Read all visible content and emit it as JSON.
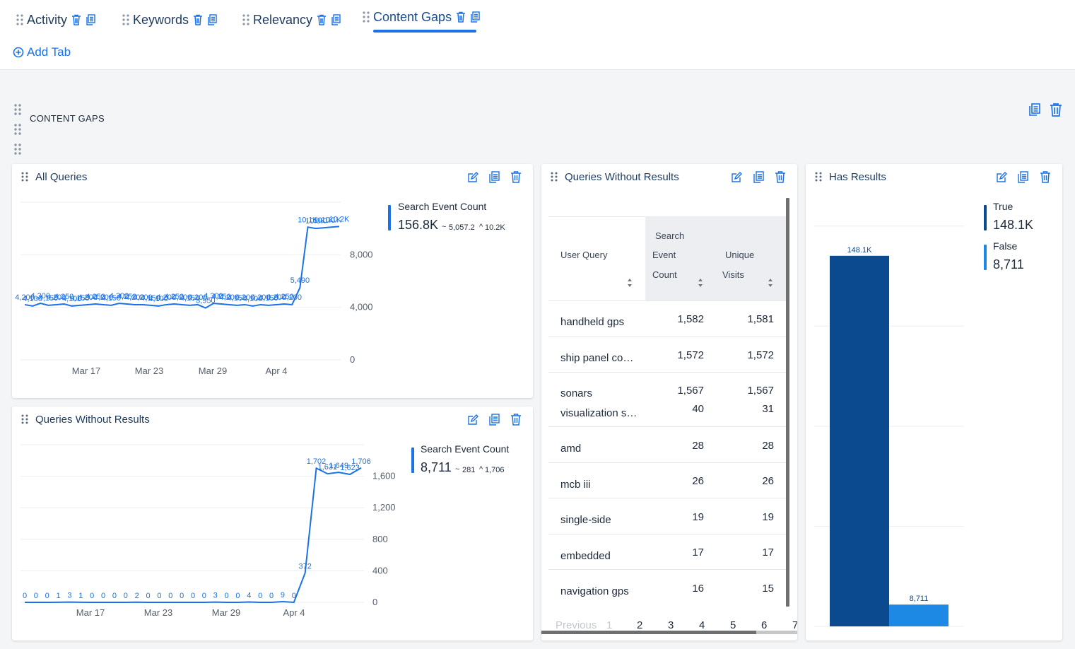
{
  "tabs": [
    {
      "label": "Activity"
    },
    {
      "label": "Keywords"
    },
    {
      "label": "Relevancy"
    },
    {
      "label": "Content Gaps"
    }
  ],
  "add_tab_label": "Add Tab",
  "section": {
    "title": "CONTENT GAPS"
  },
  "cards": {
    "all_queries": {
      "title": "All Queries",
      "legend_label": "Search Event Count",
      "legend_value": "156.8K",
      "legend_avg": "5,057.2",
      "legend_max": "10.2K",
      "legend_avg_symbol": "~",
      "legend_max_symbol": "^"
    },
    "queries_without_results_chart": {
      "title": "Queries Without Results",
      "legend_label": "Search Event Count",
      "legend_value": "8,711",
      "legend_avg": "281",
      "legend_max": "1,706",
      "legend_avg_symbol": "~",
      "legend_max_symbol": "^"
    },
    "queries_without_results_table": {
      "title": "Queries Without Results",
      "columns": [
        "User Query",
        "Search Event Count",
        "Unique Visits"
      ],
      "col2_lines": [
        "Search",
        "Event",
        "Count"
      ],
      "col3_lines": [
        "Unique",
        "Visits"
      ],
      "rows": [
        {
          "query": "handheld gps",
          "count": "1,582",
          "visits": "1,581"
        },
        {
          "query": "ship panel co…",
          "count": "1,572",
          "visits": "1,572"
        },
        {
          "query": "sonars",
          "count": "1,567",
          "visits": "1,567"
        },
        {
          "query": "visualization s…",
          "count": "40",
          "visits": "31"
        },
        {
          "query": "amd",
          "count": "28",
          "visits": "28"
        },
        {
          "query": "mcb iii",
          "count": "26",
          "visits": "26"
        },
        {
          "query": "single-side",
          "count": "19",
          "visits": "19"
        },
        {
          "query": "embedded",
          "count": "17",
          "visits": "17"
        },
        {
          "query": "navigation gps",
          "count": "16",
          "visits": "15"
        }
      ],
      "pager": {
        "previous": "Previous",
        "pages": [
          "1",
          "2",
          "3",
          "4",
          "5",
          "6",
          "7"
        ]
      }
    },
    "has_results": {
      "title": "Has Results",
      "legend": [
        {
          "label": "True",
          "value": "148.1K"
        },
        {
          "label": "False",
          "value": "8,711"
        }
      ]
    }
  },
  "colors": {
    "accent": "#1b72e8",
    "dark_blue": "#0b4a8f",
    "light_blue": "#1e88e5",
    "title_blue": "#1e3a5f",
    "line": "#1b72e8"
  },
  "chart_data": [
    {
      "type": "line",
      "title": "All Queries",
      "series": [
        {
          "name": "Search Event Count",
          "values": [
            4200,
            4100,
            4300,
            4150,
            4200,
            4250,
            4100,
            4150,
            4200,
            4250,
            4200,
            4150,
            4300,
            4250,
            4200,
            4200,
            4150,
            4100,
            4200,
            4250,
            4200,
            4150,
            4200,
            3950,
            4300,
            4250,
            4200,
            4150,
            4200,
            4100,
            4200,
            4150,
            4200,
            4250,
            4200,
            5490,
            10100,
            10000,
            10050,
            10100,
            10150
          ]
        }
      ],
      "x_tick_labels": [
        "Mar 17",
        "Mar 23",
        "Mar 29",
        "Apr 4"
      ],
      "y_tick_labels": [
        "0",
        "4,000",
        "8,000"
      ],
      "ylim": [
        0,
        12000
      ]
    },
    {
      "type": "line",
      "title": "Queries Without Results",
      "series": [
        {
          "name": "Search Event Count",
          "values": [
            0,
            0,
            0,
            1,
            3,
            1,
            0,
            0,
            0,
            0,
            2,
            0,
            0,
            0,
            0,
            0,
            0,
            3,
            0,
            0,
            4,
            0,
            0,
            9,
            0,
            372,
            1702,
            1631,
            1649,
            1623,
            1706
          ]
        }
      ],
      "point_labels": [
        "0",
        "0",
        "0",
        "1",
        "3",
        "1",
        "0",
        "0",
        "0",
        "0",
        "2",
        "0",
        "0",
        "0",
        "0",
        "0",
        "0",
        "3",
        "0",
        "0",
        "4",
        "0",
        "0",
        "9",
        "0",
        "372",
        "1,702",
        "1,631",
        "1,649",
        "1,623",
        "1,706"
      ],
      "x_tick_labels": [
        "Mar 17",
        "Mar 23",
        "Mar 29",
        "Apr 4"
      ],
      "y_tick_labels": [
        "0",
        "400",
        "800",
        "1,200",
        "1,600"
      ],
      "ylim": [
        0,
        2000
      ]
    },
    {
      "type": "bar",
      "title": "Has Results",
      "categories": [
        "True",
        "False"
      ],
      "values": [
        148100,
        8711
      ],
      "value_labels": [
        "148.1K",
        "8,711"
      ],
      "ylim": [
        0,
        165000
      ]
    }
  ]
}
